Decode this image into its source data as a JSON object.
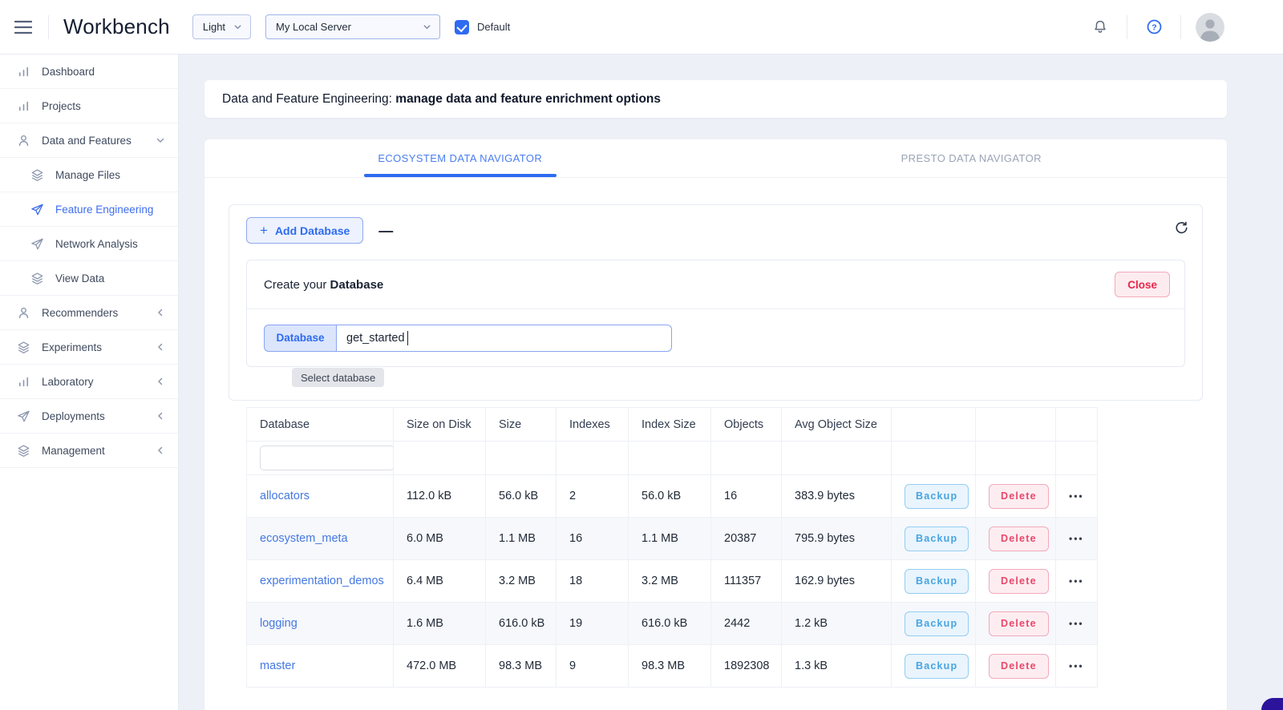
{
  "header": {
    "title": "Workbench",
    "theme_select_value": "Light",
    "server_select_value": "My Local Server",
    "default_checkbox_label": "Default"
  },
  "sidebar": {
    "items": [
      {
        "label": "Dashboard",
        "icon": "bar-chart",
        "sub": false,
        "chevron": null,
        "active": false
      },
      {
        "label": "Projects",
        "icon": "bar-chart",
        "sub": false,
        "chevron": null,
        "active": false
      },
      {
        "label": "Data and Features",
        "icon": "user",
        "sub": false,
        "chevron": "down",
        "active": false
      },
      {
        "label": "Manage Files",
        "icon": "layers",
        "sub": true,
        "chevron": null,
        "active": false
      },
      {
        "label": "Feature Engineering",
        "icon": "send",
        "sub": true,
        "chevron": null,
        "active": true
      },
      {
        "label": "Network Analysis",
        "icon": "send",
        "sub": true,
        "chevron": null,
        "active": false
      },
      {
        "label": "View Data",
        "icon": "layers",
        "sub": true,
        "chevron": null,
        "active": false
      },
      {
        "label": "Recommenders",
        "icon": "user",
        "sub": false,
        "chevron": "left",
        "active": false
      },
      {
        "label": "Experiments",
        "icon": "layers",
        "sub": false,
        "chevron": "left",
        "active": false
      },
      {
        "label": "Laboratory",
        "icon": "bar-chart",
        "sub": false,
        "chevron": "left",
        "active": false
      },
      {
        "label": "Deployments",
        "icon": "send",
        "sub": false,
        "chevron": "left",
        "active": false
      },
      {
        "label": "Management",
        "icon": "layers",
        "sub": false,
        "chevron": "left",
        "active": false
      }
    ]
  },
  "banner": {
    "prefix": "Data and Feature Engineering: ",
    "bold": "manage data and feature enrichment options"
  },
  "tabs": [
    {
      "label": "ECOSYSTEM DATA NAVIGATOR",
      "active": true
    },
    {
      "label": "PRESTO DATA NAVIGATOR",
      "active": false
    }
  ],
  "toolbar": {
    "add_database_label": "Add Database"
  },
  "create_panel": {
    "title_prefix": "Create your ",
    "title_bold": "Database",
    "close_label": "Close",
    "field_label": "Database",
    "field_value": "get_started",
    "tooltip": "Select database"
  },
  "table": {
    "columns": [
      "Database",
      "Size on Disk",
      "Size",
      "Indexes",
      "Index Size",
      "Objects",
      "Avg Object Size"
    ],
    "backup_label": "Backup",
    "delete_label": "Delete",
    "rows": [
      {
        "database": "allocators",
        "size_on_disk": "112.0 kB",
        "size": "56.0 kB",
        "indexes": "2",
        "index_size": "56.0 kB",
        "objects": "16",
        "avg_object_size": "383.9 bytes"
      },
      {
        "database": "ecosystem_meta",
        "size_on_disk": "6.0 MB",
        "size": "1.1 MB",
        "indexes": "16",
        "index_size": "1.1 MB",
        "objects": "20387",
        "avg_object_size": "795.9 bytes"
      },
      {
        "database": "experimentation_demos",
        "size_on_disk": "6.4 MB",
        "size": "3.2 MB",
        "indexes": "18",
        "index_size": "3.2 MB",
        "objects": "111357",
        "avg_object_size": "162.9 bytes"
      },
      {
        "database": "logging",
        "size_on_disk": "1.6 MB",
        "size": "616.0 kB",
        "indexes": "19",
        "index_size": "616.0 kB",
        "objects": "2442",
        "avg_object_size": "1.2 kB"
      },
      {
        "database": "master",
        "size_on_disk": "472.0 MB",
        "size": "98.3 MB",
        "indexes": "9",
        "index_size": "98.3 MB",
        "objects": "1892308",
        "avg_object_size": "1.3 kB"
      }
    ]
  },
  "icons": {
    "more_label": "•••"
  },
  "colors": {
    "accent_blue": "#2e6bf0",
    "tab_active_blue": "#4a7df0",
    "link_blue": "#4478e0",
    "backup_blue": "#47a4e0",
    "danger_red": "#e8486a",
    "page_background": "#edf0f6",
    "fab_indigo": "#2b149b"
  }
}
